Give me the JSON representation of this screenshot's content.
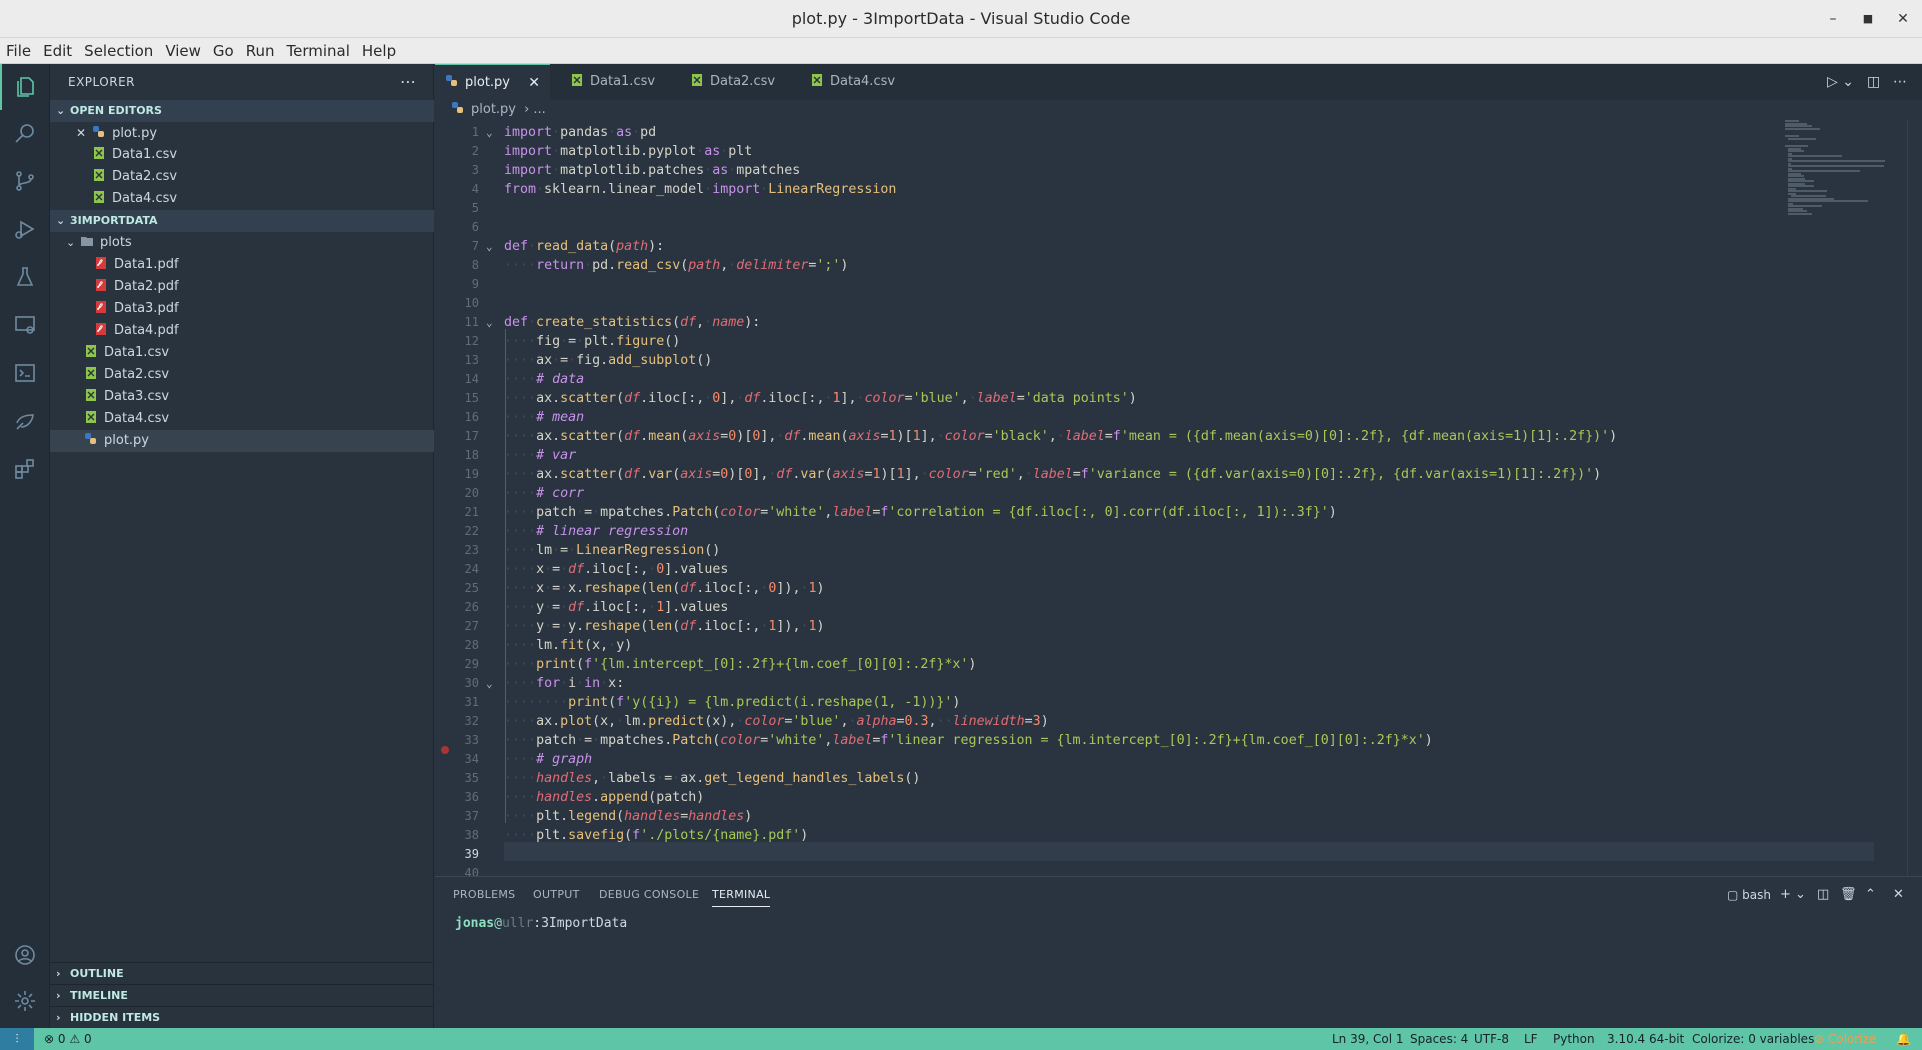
{
  "window": {
    "title": "plot.py - 3ImportData - Visual Studio Code"
  },
  "menu": [
    "File",
    "Edit",
    "Selection",
    "View",
    "Go",
    "Run",
    "Terminal",
    "Help"
  ],
  "sidebar": {
    "title": "EXPLORER",
    "open_editors_label": "OPEN EDITORS",
    "open_editors": [
      "plot.py",
      "Data1.csv",
      "Data2.csv",
      "Data4.csv"
    ],
    "workspace_label": "3IMPORTDATA",
    "folder": "plots",
    "pdfs": [
      "Data1.pdf",
      "Data2.pdf",
      "Data3.pdf",
      "Data4.pdf"
    ],
    "root_files": [
      "Data1.csv",
      "Data2.csv",
      "Data3.csv",
      "Data4.csv",
      "plot.py"
    ],
    "bottom_sections": [
      "OUTLINE",
      "TIMELINE",
      "HIDDEN ITEMS"
    ]
  },
  "tabs": [
    "plot.py",
    "Data1.csv",
    "Data2.csv",
    "Data4.csv"
  ],
  "breadcrumb": {
    "file": "plot.py",
    "rest": "..."
  },
  "editor": {
    "current_line": 39,
    "lines": [
      "import pandas as pd",
      "import matplotlib.pyplot as plt",
      "import matplotlib.patches as mpatches",
      "from sklearn.linear_model import LinearRegression",
      "",
      "",
      "def read_data(path):",
      "    return pd.read_csv(path, delimiter=';')",
      "",
      "",
      "def create_statistics(df, name):",
      "    fig = plt.figure()",
      "    ax = fig.add_subplot()",
      "    # data",
      "    ax.scatter(df.iloc[:, 0], df.iloc[:, 1], color='blue', label='data points')",
      "    # mean",
      "    ax.scatter(df.mean(axis=0)[0], df.mean(axis=1)[1], color='black', label=f'mean = ({df.mean(axis=0)[0]:.2f}, {df.mean(axis=1)[1]:.2f})')",
      "    # var",
      "    ax.scatter(df.var(axis=0)[0], df.var(axis=1)[1], color='red', label=f'variance = ({df.var(axis=0)[0]:.2f}, {df.var(axis=1)[1]:.2f})')",
      "    # corr",
      "    patch = mpatches.Patch(color='white',label=f'correlation = {df.iloc[:, 0].corr(df.iloc[:, 1]):.3f}')",
      "    # linear regression",
      "    lm = LinearRegression()",
      "    x = df.iloc[:, 0].values",
      "    x = x.reshape(len(df.iloc[:, 0]), 1)",
      "    y = df.iloc[:, 1].values",
      "    y = y.reshape(len(df.iloc[:, 1]), 1)",
      "    lm.fit(x, y)",
      "    print(f'{lm.intercept_[0]:.2f}+{lm.coef_[0][0]:.2f}*x')",
      "    for i in x:",
      "        print(f'y({i}) = {lm.predict(i.reshape(1, -1))}')",
      "    ax.plot(x, lm.predict(x), color='blue', alpha=0.3,  linewidth=3)",
      "    patch = mpatches.Patch(color='white',label=f'linear regression = {lm.intercept_[0]:.2f}+{lm.coef_[0][0]:.2f}*x')",
      "    # graph",
      "    handles, labels = ax.get_legend_handles_labels()",
      "    handles.append(patch)",
      "    plt.legend(handles=handles)",
      "    plt.savefig(f'./plots/{name}.pdf')",
      "",
      ""
    ]
  },
  "panel": {
    "tabs": [
      "PROBLEMS",
      "OUTPUT",
      "DEBUG CONSOLE",
      "TERMINAL"
    ],
    "shell": "bash",
    "prompt_user": "jonas",
    "prompt_at": "@",
    "prompt_host": "ullr",
    "prompt_sep": ":",
    "prompt_path": "3ImportData"
  },
  "status": {
    "errors": "0",
    "warnings": "0",
    "position": "Ln 39, Col 1",
    "spaces": "Spaces: 4",
    "encoding": "UTF-8",
    "eol": "LF",
    "language": "Python",
    "interpreter": "3.10.4 64-bit",
    "colorize": "Colorize: 0 variables",
    "colorize_btn": "Colorize"
  },
  "colors": {
    "accent": "#5ec6a6",
    "statusbar": "#5ec6a6",
    "bg": "#2a3440"
  }
}
